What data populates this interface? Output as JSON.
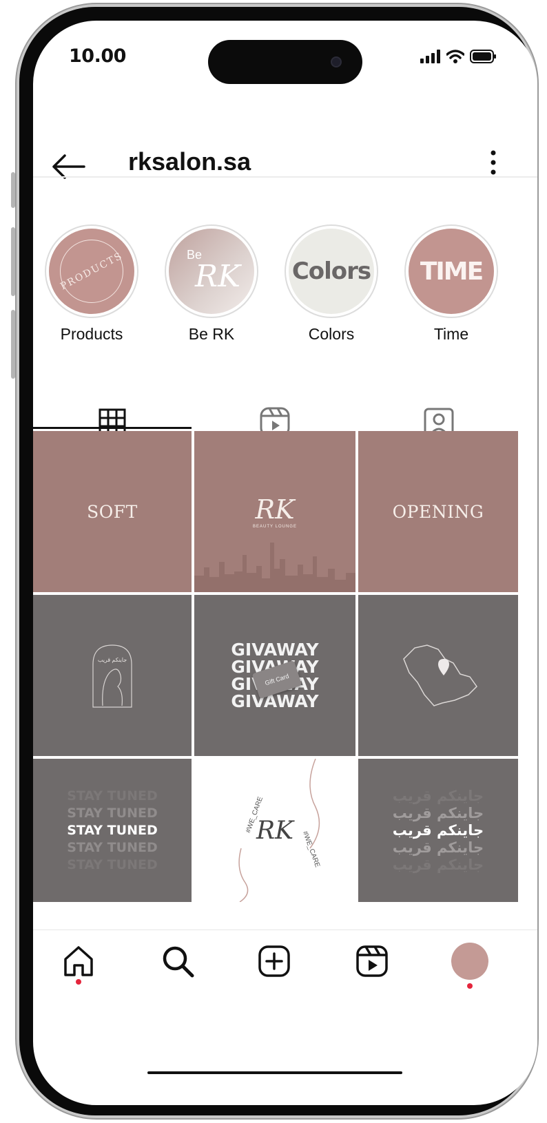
{
  "status_bar": {
    "time": "10.00"
  },
  "header": {
    "username": "rksalon.sa"
  },
  "highlights": [
    {
      "label": "Products",
      "cover_text": "PRODUCTS"
    },
    {
      "label": "Be RK",
      "cover_text_1": "Be",
      "cover_text_2": "RK"
    },
    {
      "label": "Colors",
      "cover_text": "Colors"
    },
    {
      "label": "Time",
      "cover_text": "TIME"
    }
  ],
  "tabs": [
    {
      "icon": "grid-icon",
      "active": true
    },
    {
      "icon": "reels-icon",
      "active": false
    },
    {
      "icon": "tagged-icon",
      "active": false
    }
  ],
  "posts": {
    "soft": "SOFT",
    "rk_logo": "RK",
    "rk_sub": "BEAUTY LOUNGE",
    "opening": "OPENING",
    "arabic_near": "جاينكم قريب",
    "giveaway": [
      "GIVAWAY",
      "GIVAWAY",
      "GIVAWAY",
      "GIVAWAY"
    ],
    "gift_card": "Gift Card",
    "stay_tuned": [
      "STAY TUNED",
      "STAY TUNED",
      "STAY TUNED",
      "STAY TUNED",
      "STAY TUNED"
    ],
    "we_care_1": "#WE_CARE",
    "we_care_2": "#WE_CARE",
    "arabic_lines": [
      "جاينكم قريب",
      "جاينكم قريب",
      "جاينكم قريب",
      "جاينكم قريب",
      "جاينكم قريب"
    ]
  },
  "colors": {
    "rose": "#a27e79",
    "grey": "#6f6b6b",
    "notification_dot": "#e4253c"
  },
  "bottom_nav": [
    "home-icon",
    "search-icon",
    "create-icon",
    "reels-icon",
    "profile-avatar"
  ]
}
